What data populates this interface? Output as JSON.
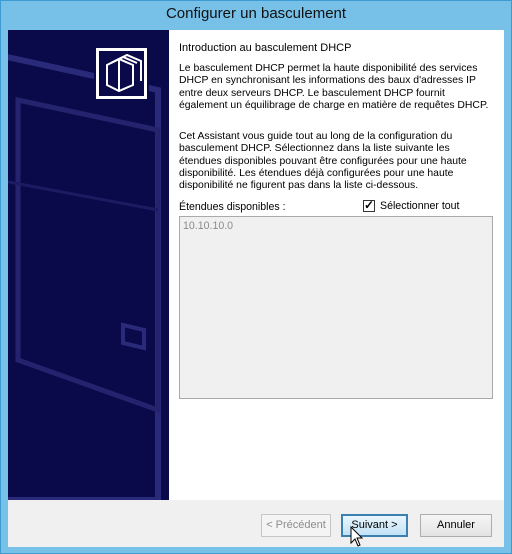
{
  "window": {
    "title": "Configurer un basculement"
  },
  "page": {
    "heading": "Introduction au basculement DHCP",
    "paragraph1": "Le basculement DHCP permet la haute disponibilité des services DHCP en synchronisant les informations des baux d'adresses IP entre deux serveurs DHCP. Le basculement DHCP fournit également un équilibrage de charge en matière de requêtes DHCP.",
    "paragraph2": "Cet Assistant vous guide tout au long de la configuration du basculement DHCP. Sélectionnez dans la liste suivante les étendues disponibles pouvant être configurées pour une haute disponibilité. Les étendues déjà configurées pour une haute disponibilité ne figurent pas dans la liste ci-dessous."
  },
  "scopes": {
    "label": "Étendues disponibles :",
    "select_all_label": "Sélectionner tout",
    "select_all_checked": true,
    "items": [
      "10.10.10.0"
    ]
  },
  "buttons": {
    "previous": "< Précédent",
    "next": "Suivant >",
    "cancel": "Annuler"
  },
  "icons": {
    "wizard": "folder-stack-icon",
    "cursor": "mouse-pointer-icon"
  }
}
